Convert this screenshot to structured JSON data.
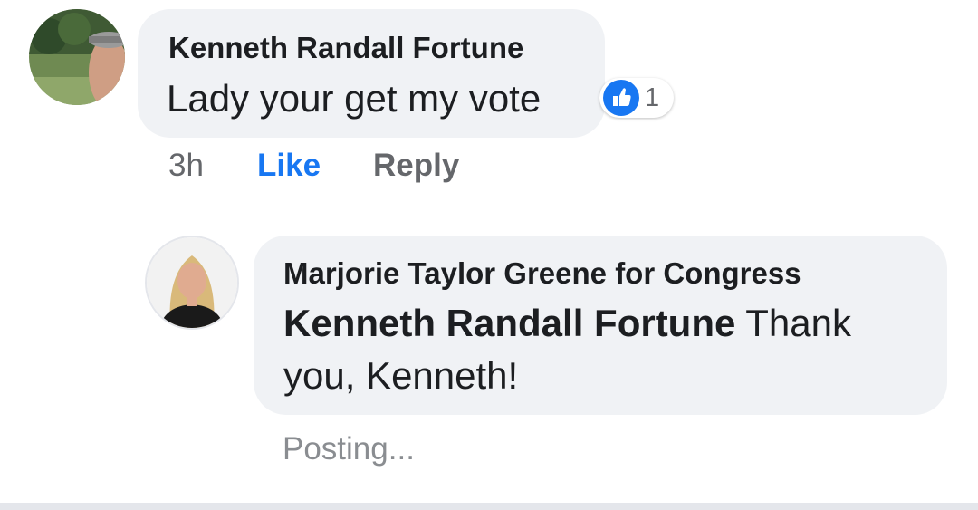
{
  "comment": {
    "author": "Kenneth Randall Fortune",
    "text": "Lady your get my vote",
    "timestamp": "3h",
    "like_label": "Like",
    "reply_label": "Reply",
    "reaction_icon": "thumbs-up-icon",
    "reaction_count": "1"
  },
  "reply": {
    "author": "Marjorie Taylor Greene for Congress",
    "mention": "Kenneth Randall Fortune",
    "text_after_mention": " Thank you, Kenneth!",
    "status": "Posting..."
  },
  "colors": {
    "bubble_bg": "#f0f2f5",
    "like_blue": "#1877f2",
    "meta_gray": "#65676b",
    "text": "#1c1e21"
  }
}
